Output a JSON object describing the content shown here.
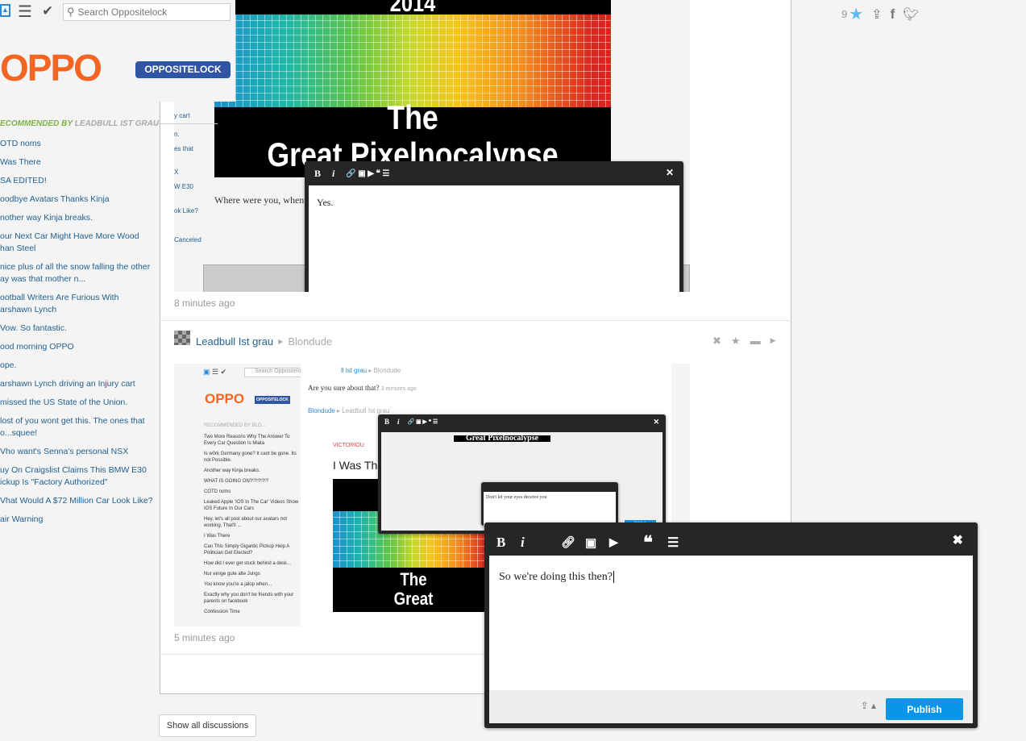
{
  "topbar": {
    "search_placeholder": "Search Oppositelock",
    "icons": [
      "user-icon",
      "menu-icon",
      "check-icon",
      "search-icon"
    ]
  },
  "logo": {
    "text": "OPPO",
    "badge": "OPPOSITELOCK"
  },
  "sidebar": {
    "recommended_label": "ECOMMENDED BY",
    "recommended_by": "LEADBULL IST GRAU",
    "items": [
      "OTD noms",
      "Was There",
      "SA EDITED!",
      "oodbye Avatars Thanks Kinja",
      "nother way Kinja breaks.",
      "our Next Car Might Have More Wood\nhan Steel",
      "nice plus of all the snow falling the other\nay was that mother n...",
      "ootball Writers Are Furious With\narshawn Lynch",
      "Vow. So fantastic.",
      "ood morning OPPO",
      "ope.",
      "arshawn Lynch driving an Injury cart",
      "missed the US State of the Union.",
      "lost of you wont get this. The ones that\no...squee!",
      "Vho want's Senna's personal NSX",
      "uy On Craigslist Claims This BMW E30\nickup Is \"Factory Authorized\"",
      "Vhat Would A $72 Million Car Look Like?",
      "air Warning"
    ]
  },
  "share": {
    "count": "9",
    "icons": [
      "star-icon",
      "share-icon",
      "facebook-icon",
      "twitter-icon"
    ],
    "star_color": "#5fb8f0"
  },
  "comment1": {
    "image_text": {
      "year": "2014",
      "line1": "The",
      "line2": "Great Pixelnocalypse"
    },
    "body_fragment": "Where were you, when",
    "side_fragments": [
      "y cart",
      "n.",
      "es that",
      "X",
      "W E30",
      "ok Like?",
      "Canceled"
    ],
    "editor_text": "Yes.",
    "time": "8 minutes ago"
  },
  "comment2": {
    "author": "Leadbull Ist grau",
    "reply_to": "Blondude",
    "time": "5 minutes ago",
    "actions": [
      "dismiss-icon",
      "star-icon",
      "reply-icon",
      "more-icon"
    ],
    "thumb": {
      "search": "Search Oppositelock",
      "reply_header_author": "ll ist grau",
      "reply_header_to": "Blondude",
      "question": "Are you sure about that?",
      "question_time": "3 minutes ago",
      "author2": "Blondude",
      "to2": "Leadbull Ist grau",
      "rec": "RECOMMENDED BY BLO...",
      "victorious": "VICTORIOU",
      "post_title": "I Was The",
      "items": [
        "Two More Reasons Why The Answer To Every Car Question Is Miata",
        "Is w0rk Germany gone? It cant be gone. Its not Possible.",
        "Another way Kinja breaks.",
        "WHAT IS GOING ON?!?!?!?!?",
        "COTD noms",
        "Leaked Apple 'IOS In The Car' Videos Show IOS Future In Our Cars",
        "Hey, let's all post about our avatars not working. That'll ...",
        "I Was There",
        "Can This Simply Gigantic Pickup Help A Politician Get Elected?",
        "How did I ever get stuck behind a desk...",
        "Nur einige gute alte Jungs",
        "You know you're a jalop when...",
        "Exactly why you don't be friends with your parents on facebook",
        "Confession Time"
      ],
      "publish": "Publish",
      "mini_editor_text": "Don't let your eyes deceive you"
    }
  },
  "editor": {
    "text": "So we're doing this then?",
    "publish_label": "Publish",
    "publish_color": "#0a96e8",
    "tools": [
      "bold-icon",
      "italic-icon",
      "link-icon",
      "image-icon",
      "video-icon",
      "quote-icon",
      "list-icon"
    ],
    "bold": "B",
    "italic": "i"
  },
  "footer": {
    "show_all": "Show all discussions"
  }
}
